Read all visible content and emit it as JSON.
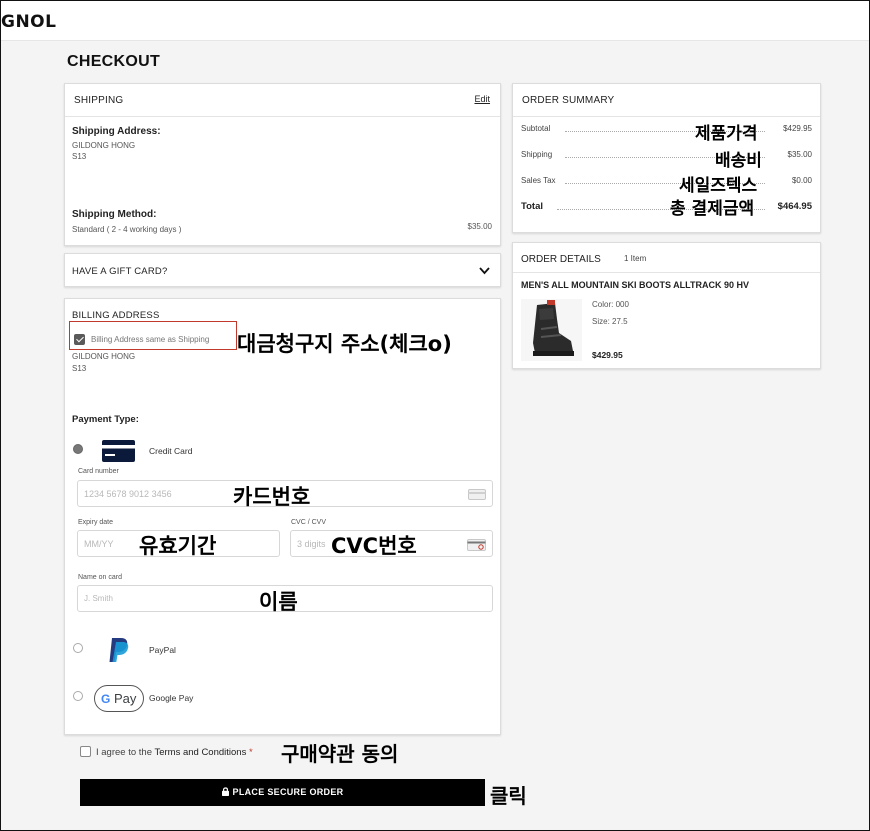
{
  "header": {
    "logo": "GNOL"
  },
  "page_title": "CHECKOUT",
  "shipping": {
    "title": "SHIPPING",
    "edit_label": "Edit",
    "address_label": "Shipping Address:",
    "name": "GILDONG HONG",
    "line2": "S13",
    "method_label": "Shipping Method:",
    "method_value": "Standard ( 2 - 4 working days )",
    "method_price": "$35.00"
  },
  "gift_card": {
    "title": "HAVE A GIFT CARD?"
  },
  "billing": {
    "title": "BILLING ADDRESS",
    "same_as_shipping_label": "Billing Address same as Shipping",
    "same_as_shipping_checked": true,
    "name": "GILDONG HONG",
    "line2": "S13",
    "annotation": "대금청구지 주소(체크o)"
  },
  "payment": {
    "type_label": "Payment Type:",
    "credit_card_label": "Credit Card",
    "card_number_label": "Card number",
    "card_number_placeholder": "1234 5678 9012 3456",
    "card_number_annotation": "카드번호",
    "expiry_label": "Expiry date",
    "expiry_placeholder": "MM/YY",
    "expiry_annotation": "유효기간",
    "cvc_label": "CVC / CVV",
    "cvc_placeholder": "3 digits",
    "cvc_annotation": "CVC번호",
    "name_label": "Name on card",
    "name_placeholder": "J. Smith",
    "name_annotation": "이름",
    "paypal_label": "PayPal",
    "googlepay_label": "Google Pay",
    "googlepay_badge_g": "G",
    "googlepay_badge_pay": "Pay",
    "selected": "credit_card"
  },
  "terms": {
    "prefix": "I agree to the ",
    "link": "Terms and Conditions",
    "required_mark": "*",
    "annotation": "구매약관 동의"
  },
  "place_order": {
    "label": "PLACE SECURE ORDER",
    "annotation": "클릭"
  },
  "order_summary": {
    "title": "ORDER SUMMARY",
    "rows": [
      {
        "label": "Subtotal",
        "value": "$429.95",
        "annotation": "제품가격"
      },
      {
        "label": "Shipping",
        "value": "$35.00",
        "annotation": "배송비"
      },
      {
        "label": "Sales Tax",
        "value": "$0.00",
        "annotation": "세일즈텍스"
      },
      {
        "label": "Total",
        "value": "$464.95",
        "annotation": "총 결제금액"
      }
    ]
  },
  "order_details": {
    "title": "ORDER DETAILS",
    "count": "1 Item",
    "product_name": "MEN'S ALL MOUNTAIN SKI BOOTS ALLTRACK 90 HV",
    "color": "Color: 000",
    "size": "Size: 27.5",
    "price": "$429.95"
  },
  "colors": {
    "accent": "#000000",
    "annotation_box": "#c0392b",
    "required": "#c0392b"
  }
}
